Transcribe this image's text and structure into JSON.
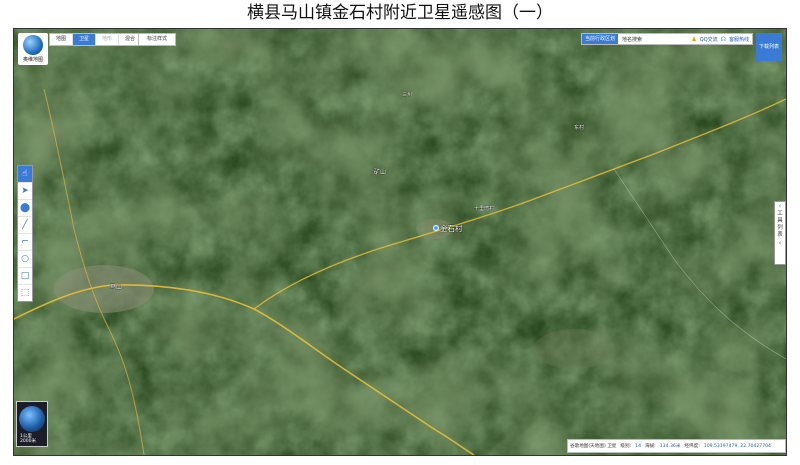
{
  "page_title": "横县马山镇金石村附近卫星遥感图（一）",
  "app": {
    "logo_text": "奥维地图",
    "map_types": [
      {
        "label": "地图",
        "active": false,
        "disabled": false
      },
      {
        "label": "卫星",
        "active": true,
        "disabled": false
      },
      {
        "label": "地形",
        "active": false,
        "disabled": true
      },
      {
        "label": "混合",
        "active": false,
        "disabled": false
      }
    ],
    "label_style_button": "标注样式",
    "range_button": "当前行政区划",
    "place_search": "地名搜索",
    "qq_label": "QQ交流",
    "service_label": "客服热线",
    "download_list": "下载列表",
    "side_panel_label": "工具列表"
  },
  "toolbar": [
    {
      "name": "hand-pan-icon",
      "glyph": "☝",
      "active": true
    },
    {
      "name": "arrow-select-icon",
      "glyph": "➤",
      "active": false
    },
    {
      "name": "placemark-icon",
      "glyph": "⬤",
      "active": false
    },
    {
      "name": "line-draw-icon",
      "glyph": "╱",
      "active": false
    },
    {
      "name": "measure-area-icon",
      "glyph": "⌐",
      "active": false
    },
    {
      "name": "circle-draw-icon",
      "glyph": "○",
      "active": false
    },
    {
      "name": "rectangle-draw-icon",
      "glyph": "□",
      "active": false
    },
    {
      "name": "tag-icon",
      "glyph": "⬚",
      "active": false
    }
  ],
  "status": {
    "source": "谷歌地图(天地图) 卫星",
    "level_label": "级别:",
    "level": "14",
    "altitude_label": "海拔:",
    "altitude": "134.36米",
    "lonlat_label": "经纬度:",
    "lonlat": "109.53197479, 22.70427704"
  },
  "minimap": {
    "scale": "1公里",
    "scale2": "2000米"
  },
  "places": {
    "jinshi": "金石村",
    "mashan": "马山",
    "kuangshan": "矿山",
    "sanzhou": "三州",
    "shiliwan": "十里湾村",
    "dongcun": "东村"
  },
  "colors": {
    "accent": "#3a7bd5",
    "road": "#f1c232",
    "border": "#333333"
  }
}
